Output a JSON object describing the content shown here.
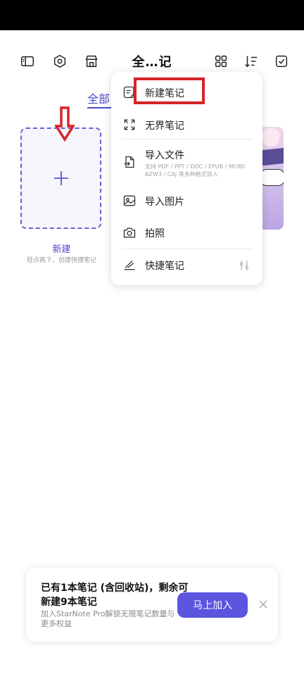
{
  "header": {
    "title": "全…记",
    "icons": [
      "sidebar-icon",
      "hexagon-settings-icon",
      "store-icon",
      "grid-view-icon",
      "sort-icon",
      "select-check-icon"
    ]
  },
  "tabs": {
    "active_label": "全部"
  },
  "new_card": {
    "label": "新建",
    "hint": "轻点两下，创建快捷笔记"
  },
  "menu": {
    "items": [
      {
        "id": "new-note",
        "label": "新建笔记",
        "icon": "new-note-icon"
      },
      {
        "id": "infinite-note",
        "label": "无界笔记",
        "icon": "expand-icon"
      },
      {
        "id": "import-file",
        "label": "导入文件",
        "sub": "支持 PDF / PPT / DOC / EPUB / MOBI/ AZW3 / CAJ 等多种格式导入",
        "icon": "import-file-icon"
      },
      {
        "id": "import-image",
        "label": "导入图片",
        "icon": "image-icon"
      },
      {
        "id": "take-photo",
        "label": "拍照",
        "icon": "camera-icon"
      },
      {
        "id": "quick-note",
        "label": "快捷笔记",
        "icon": "quick-pen-icon",
        "right_icon": "sliders-icon"
      }
    ]
  },
  "banner": {
    "title": "已有1本笔记 (含回收站)，剩余可新建9本笔记",
    "subtitle": "加入StarNote Pro解锁无限笔记数量与更多权益",
    "button_label": "马上加入"
  },
  "colors": {
    "accent": "#5b55e0",
    "highlight": "#d8232a",
    "tab": "#4b48c9"
  }
}
